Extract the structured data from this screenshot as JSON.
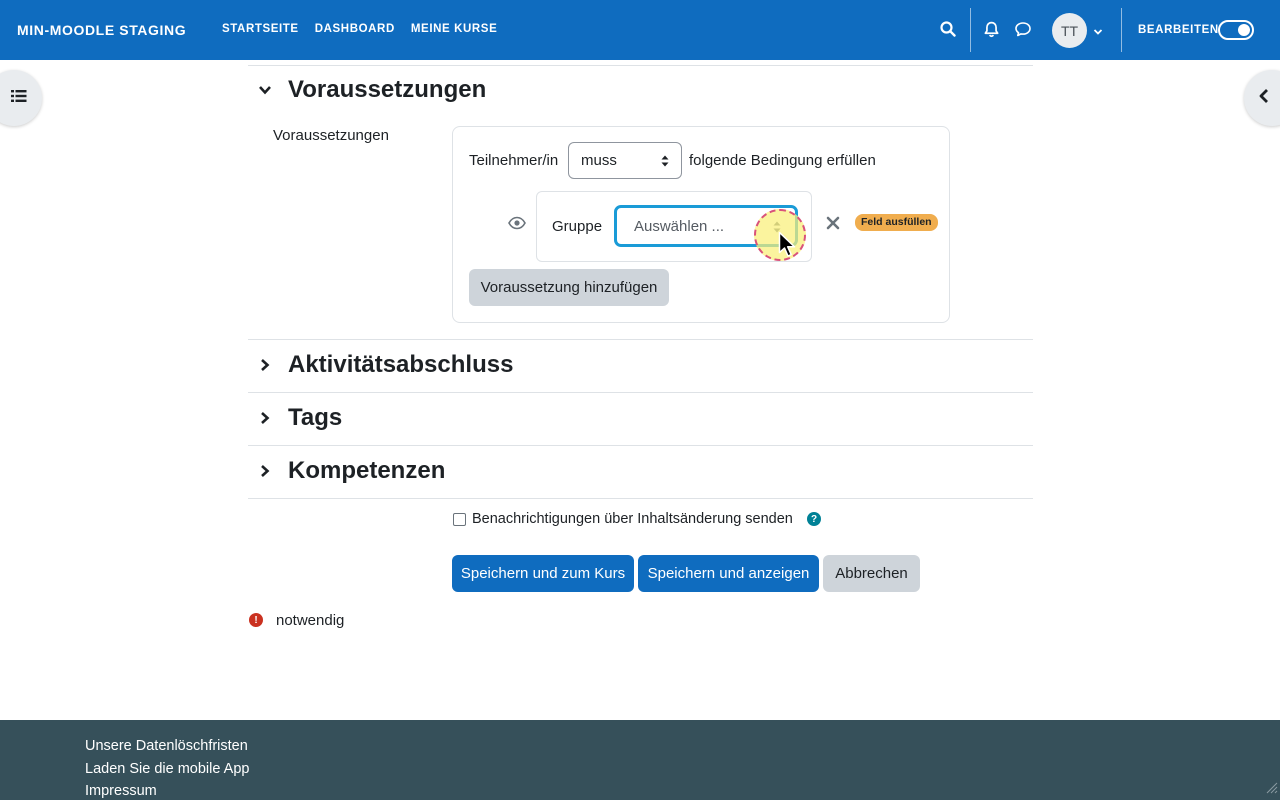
{
  "navbar": {
    "brand": "MIN-MOODLE STAGING",
    "links": [
      "STARTSEITE",
      "DASHBOARD",
      "MEINE KURSE"
    ],
    "avatar_initials": "TT",
    "edit_label": "BEARBEITEN",
    "edit_mode_on": true,
    "brand_color": "#0f6cbf"
  },
  "sections": {
    "restrict": "Voraussetzungen",
    "completion": "Aktivitätsabschluss",
    "tags": "Tags",
    "competencies": "Kompetenzen"
  },
  "restrict": {
    "field_label": "Voraussetzungen",
    "participant_label": "Teilnehmer/in",
    "must_select": "muss",
    "condition_suffix": "folgende Bedingung erfüllen",
    "group_label": "Gruppe",
    "group_select": "Auswählen ...",
    "required_badge": "Feld ausfüllen",
    "add_button": "Voraussetzung hinzufügen"
  },
  "notify": {
    "label": "Benachrichtigungen über Inhaltsänderung senden",
    "help": "?"
  },
  "actions": {
    "save_return": "Speichern und zum Kurs",
    "save_display": "Speichern und anzeigen",
    "cancel": "Abbrechen"
  },
  "required": {
    "icon": "!",
    "label": "notwendig"
  },
  "footer": {
    "links": [
      "Unsere Datenlöschfristen",
      "Laden Sie die mobile App",
      "Impressum"
    ],
    "color": "#36505a"
  }
}
